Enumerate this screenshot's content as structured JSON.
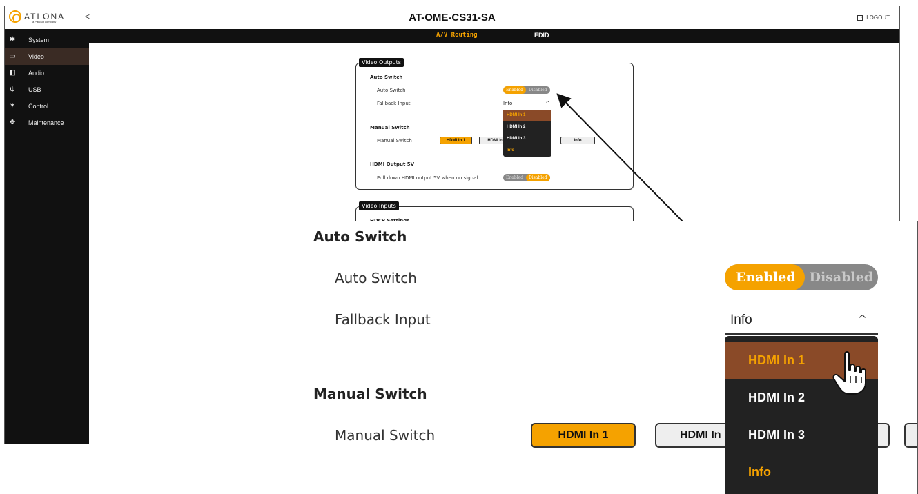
{
  "app": {
    "brand": "ATLONA",
    "brand_sub": "a Panduit company",
    "collapse_glyph": "<",
    "device_title": "AT-OME-CS31-SA",
    "logout_label": "LOGOUT"
  },
  "nav_tabs": [
    {
      "label": "A/V Routing",
      "active": true
    },
    {
      "label": "EDID",
      "active": false
    }
  ],
  "sidebar": {
    "items": [
      {
        "label": "System",
        "icon": "gear-icon",
        "active": false
      },
      {
        "label": "Video",
        "icon": "monitor-icon",
        "active": true
      },
      {
        "label": "Audio",
        "icon": "speaker-icon",
        "active": false
      },
      {
        "label": "USB",
        "icon": "usb-icon",
        "active": false
      },
      {
        "label": "Control",
        "icon": "network-icon",
        "active": false
      },
      {
        "label": "Maintenance",
        "icon": "move-arrows-icon",
        "active": false
      }
    ]
  },
  "video_outputs": {
    "tag": "Video Outputs",
    "auto_switch_title": "Auto Switch",
    "auto_switch_label": "Auto Switch",
    "toggle_on": "Enabled",
    "toggle_off": "Disabled",
    "auto_switch_value": "Enabled",
    "fallback_label": "Fallback Input",
    "fallback_value": "Info",
    "manual_switch_title": "Manual Switch",
    "manual_switch_label": "Manual Switch",
    "manual_buttons": [
      "HDMI In 1",
      "HDMI In",
      "Info"
    ],
    "manual_selected": "HDMI In 1",
    "hdmi_5v_title": "HDMI Output 5V",
    "hdmi_5v_label": "Pull down HDMI output 5V when no signal",
    "hdmi_5v_value": "Disabled",
    "dropdown_options": [
      "HDMI In 1",
      "HDMI In 2",
      "HDMI In 3",
      "Info"
    ],
    "dropdown_highlight": "HDMI In 1"
  },
  "video_inputs": {
    "tag": "Video Inputs",
    "hdcp_title": "HDCP Settings"
  },
  "zoom": {
    "auto_switch_title": "Auto Switch",
    "auto_switch_label": "Auto Switch",
    "toggle_on": "Enabled",
    "toggle_off": "Disabled",
    "fallback_label": "Fallback Input",
    "fallback_value": "Info",
    "fallback_chevron": "^",
    "manual_switch_title": "Manual Switch",
    "manual_switch_label": "Manual Switch",
    "manual_buttons": [
      "HDMI In 1",
      "HDMI In"
    ],
    "dropdown_options": [
      "HDMI In 1",
      "HDMI In 2",
      "HDMI In 3",
      "Info"
    ]
  },
  "colors": {
    "accent": "#f5a200",
    "highlight": "#8a4a28",
    "dark": "#111111",
    "sidebar_active": "#3a2b24"
  }
}
